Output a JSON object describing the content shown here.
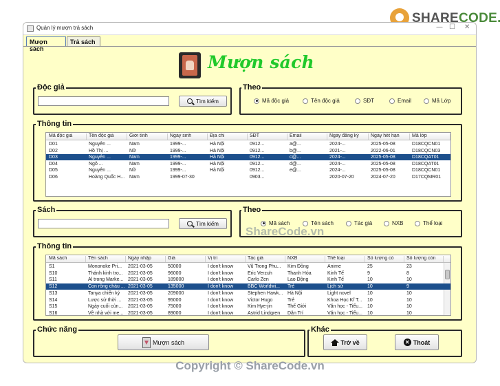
{
  "watermark": {
    "logo_prefix": "SHARE",
    "logo_suffix": "CODE.vn",
    "center": "ShareCode.vn",
    "copyright": "Copyright © ShareCode.vn"
  },
  "window": {
    "title": "Quản lý mượn trả sách",
    "minimize": "—",
    "maximize": "☐",
    "close": "✕"
  },
  "tabs": [
    {
      "label": "Mượn sách",
      "active": true
    },
    {
      "label": "Trả sách",
      "active": false
    }
  ],
  "header": {
    "title": "Mượn sách",
    "icon": "book-hand-icon"
  },
  "reader_search": {
    "group_label": "Độc giả",
    "input_value": "",
    "button_label": "Tìm kiếm",
    "filter_label": "Theo",
    "options": [
      {
        "label": "Mã độc giả",
        "selected": true
      },
      {
        "label": "Tên độc giả",
        "selected": false
      },
      {
        "label": "SĐT",
        "selected": false
      },
      {
        "label": "Email",
        "selected": false
      },
      {
        "label": "Mã Lớp",
        "selected": false
      }
    ]
  },
  "reader_table": {
    "group_label": "Thông tin",
    "columns": [
      "Mã độc giả",
      "Tên độc giả",
      "Giới tính",
      "Ngày sinh",
      "Địa chỉ",
      "SĐT",
      "Email",
      "Ngày đăng ký",
      "Ngày hết hạn",
      "Mã lớp"
    ],
    "rows": [
      {
        "cells": [
          "D01",
          "Nguyễn ...",
          "Nam",
          "1999-...",
          "Hà Nội",
          "0912...",
          "a@...",
          "2024-...",
          "2025-05-08",
          "D18CQCN01"
        ],
        "selected": false
      },
      {
        "cells": [
          "D02",
          "Hồ Thị ...",
          "Nữ",
          "1999-...",
          "Hà Nội",
          "0912...",
          "b@...",
          "2021-...",
          "2022-06-01",
          "D18CQCN03"
        ],
        "selected": false
      },
      {
        "cells": [
          "D03",
          "Nguyễn ...",
          "Nam",
          "1999-...",
          "Hà Nội",
          "0912...",
          "c@...",
          "2024-...",
          "2025-05-08",
          "D18CQAT01"
        ],
        "selected": true
      },
      {
        "cells": [
          "D04",
          "Ngô ...",
          "Nam",
          "1999-...",
          "Hà Nội",
          "0912...",
          "d@...",
          "2024-...",
          "2025-05-08",
          "D18CQAT01"
        ],
        "selected": false
      },
      {
        "cells": [
          "D05",
          "Nguyễn ...",
          "Nữ",
          "1999-...",
          "Hà Nội",
          "0912...",
          "e@...",
          "2024-...",
          "2025-05-08",
          "D18CQCN01"
        ],
        "selected": false
      },
      {
        "cells": [
          "D06",
          "Hoàng Quốc H...",
          "Nam",
          "1999-07-30",
          "",
          "0903...",
          "",
          "2020-07-20",
          "2024-07-20",
          "D17CQMR01"
        ],
        "selected": false
      }
    ]
  },
  "book_search": {
    "group_label": "Sách",
    "input_value": "",
    "button_label": "Tìm kiếm",
    "filter_label": "Theo",
    "options": [
      {
        "label": "Mã sách",
        "selected": true
      },
      {
        "label": "Tên sách",
        "selected": false
      },
      {
        "label": "Tác giả",
        "selected": false
      },
      {
        "label": "NXB",
        "selected": false
      },
      {
        "label": "Thể loại",
        "selected": false
      }
    ]
  },
  "book_table": {
    "group_label": "Thông tin",
    "columns": [
      "Mã sách",
      "Tên sách",
      "Ngày nhập",
      "Giá",
      "Vị trí",
      "Tác giả",
      "NXB",
      "Thể loại",
      "Số lượng có",
      "Số lượng còn"
    ],
    "rows": [
      {
        "cells": [
          "S1",
          "Mononoke Pri...",
          "2021-03-05",
          "50000",
          "I don't know",
          "Vũ Trong Phu...",
          "Kim Đồng",
          "Anime",
          "25",
          "23"
        ],
        "selected": false
      },
      {
        "cells": [
          "S10",
          "Thánh kinh tro...",
          "2021-03-05",
          "96000",
          "I don't know",
          "Eric Verzuh",
          "Thanh Hóa",
          "Kinh Tế",
          "9",
          "8"
        ],
        "selected": false
      },
      {
        "cells": [
          "S11",
          "Al trong Marke...",
          "2021-03-05",
          "189000",
          "I don't know",
          "Carlo Zen",
          "Lao Động",
          "Kinh Tế",
          "10",
          "10"
        ],
        "selected": false
      },
      {
        "cells": [
          "S12",
          "Con rồng cháu ...",
          "2021-03-05",
          "135000",
          "I don't know",
          "BBC Worldwi...",
          "Trẻ",
          "Lịch sử",
          "10",
          "9"
        ],
        "selected": true
      },
      {
        "cells": [
          "S13",
          "Tanya chiến ký",
          "2021-03-05",
          "209000",
          "I don't know",
          "Stephen Hawk...",
          "Hà Nội",
          "Light novel",
          "10",
          "10"
        ],
        "selected": false
      },
      {
        "cells": [
          "S14",
          "Lược sử thời ...",
          "2021-03-05",
          "95000",
          "I don't know",
          "Victor Hugo",
          "Trẻ",
          "Khoa Học Kĩ T...",
          "10",
          "10"
        ],
        "selected": false
      },
      {
        "cells": [
          "S15",
          "Ngày cuối cùn...",
          "2021-03-05",
          "75000",
          "I don't know",
          "Kim Hye-jin",
          "Thế Giới",
          "Văn học - Tiểu...",
          "10",
          "10"
        ],
        "selected": false
      },
      {
        "cells": [
          "S16",
          "Về nhà với me...",
          "2021-03-05",
          "89000",
          "I don't know",
          "Astrid Lindgren",
          "Dân Trí",
          "Văn học - Tiểu...",
          "10",
          "10"
        ],
        "selected": false
      }
    ]
  },
  "functions": {
    "group_label": "Chức năng",
    "borrow_button": "Mượn sách"
  },
  "other": {
    "group_label": "Khác",
    "back_button": "Trở về",
    "exit_button": "Thoát"
  }
}
